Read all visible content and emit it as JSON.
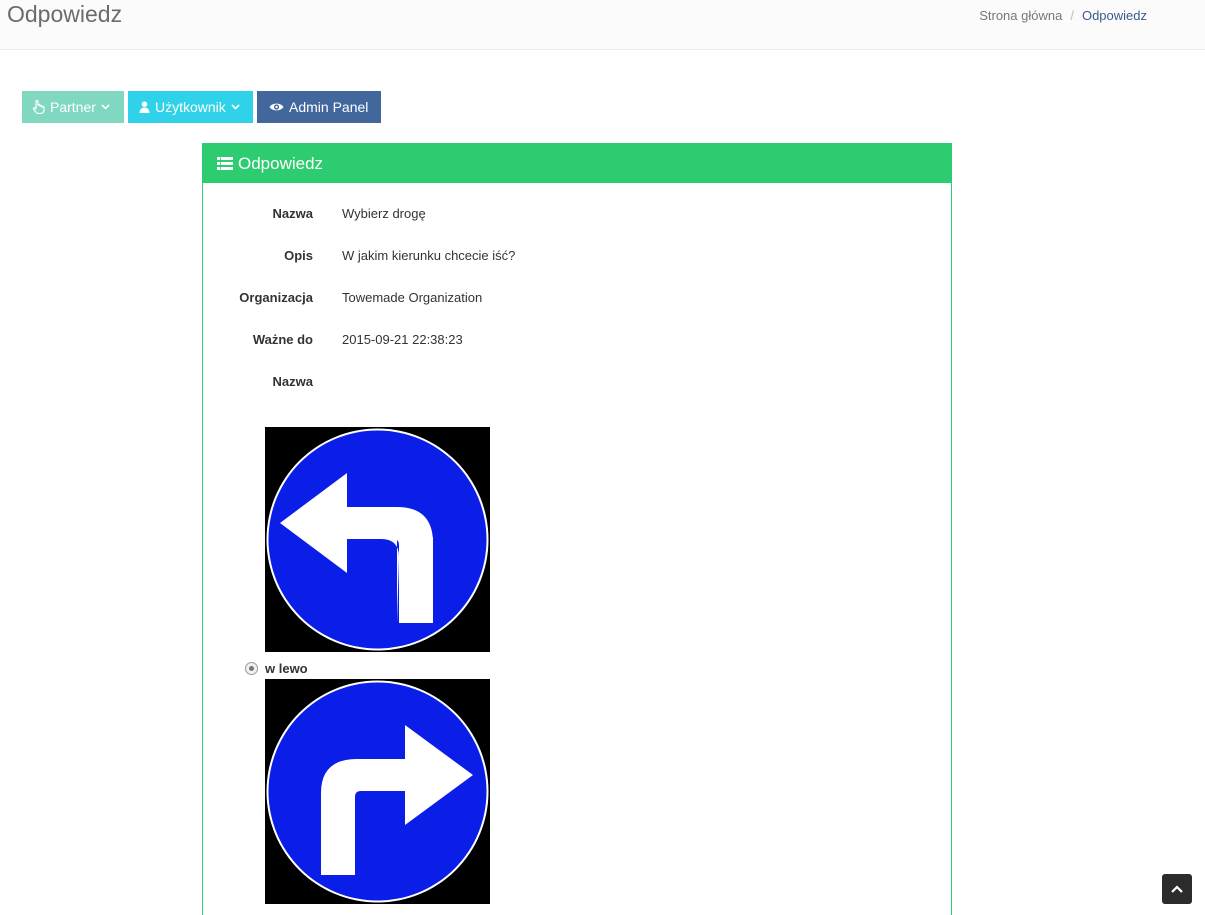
{
  "header": {
    "title": "Odpowiedz",
    "breadcrumb": {
      "home": "Strona główna",
      "separator": "/",
      "current": "Odpowiedz"
    }
  },
  "toolbar": {
    "partner_label": "Partner",
    "user_label": "Użytkownik",
    "admin_label": "Admin Panel"
  },
  "panel": {
    "title": "Odpowiedz",
    "fields": [
      {
        "label": "Nazwa",
        "value": "Wybierz drogę"
      },
      {
        "label": "Opis",
        "value": "W jakim kierunku chcecie iść?"
      },
      {
        "label": "Organizacja",
        "value": "Towemade Organization"
      },
      {
        "label": "Ważne do",
        "value": "2015-09-21 22:38:23"
      },
      {
        "label": "Nazwa",
        "value": ""
      }
    ],
    "answers": [
      {
        "image_icon": "turn-left-sign-icon",
        "label": "w lewo",
        "selected": true
      },
      {
        "image_icon": "turn-right-sign-icon",
        "label": ""
      }
    ]
  },
  "colors": {
    "panel_accent": "#2ecc71",
    "partner_btn": "#7fd8bf",
    "user_btn": "#2fd2e8",
    "admin_btn": "#42679d",
    "sign_blue": "#0b1ee8"
  }
}
